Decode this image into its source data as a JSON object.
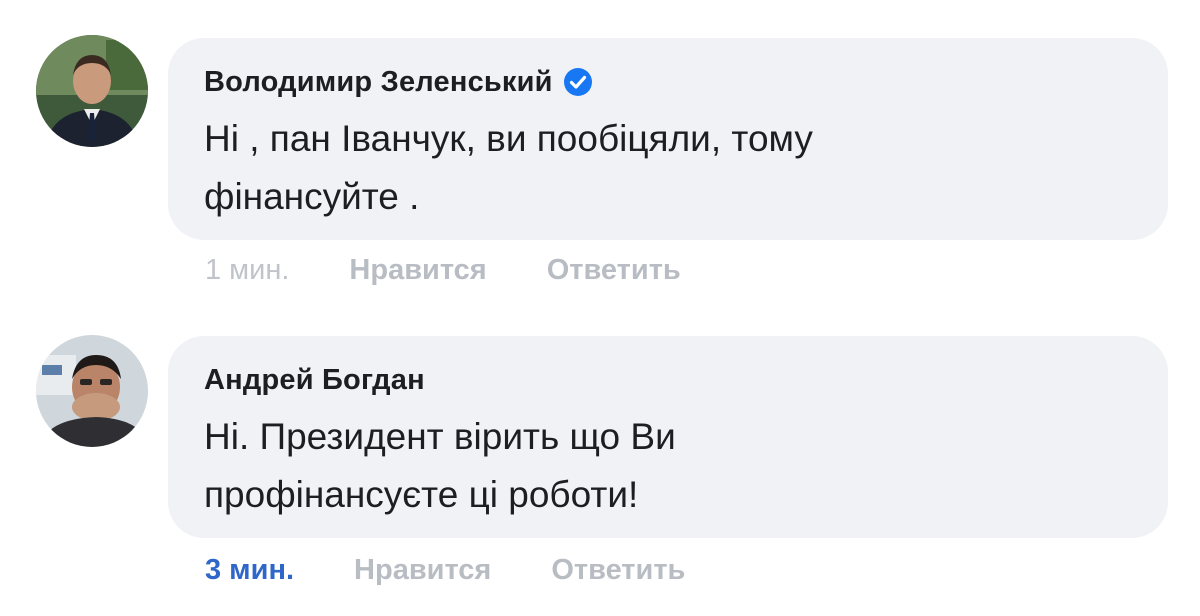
{
  "comments": [
    {
      "author": "Володимир Зеленський",
      "verified": true,
      "text_line1": "Ні , пан Іванчук, ви пообіцяли, тому",
      "text_line2": "фінансуйте .",
      "time": "1 мин.",
      "like_label": "Нравится",
      "reply_label": "Ответить"
    },
    {
      "author": "Андрей Богдан",
      "verified": false,
      "text_line1": "Ні. Президент вірить що Ви",
      "text_line2": "профінансуєте ці роботи!",
      "time": "3 мин.",
      "like_label": "Нравится",
      "reply_label": "Ответить"
    }
  ],
  "colors": {
    "bubble": "#f0f2f5",
    "verified_badge": "#1877f2",
    "link": "#2f66c9",
    "muted": "#b8bcc3"
  }
}
